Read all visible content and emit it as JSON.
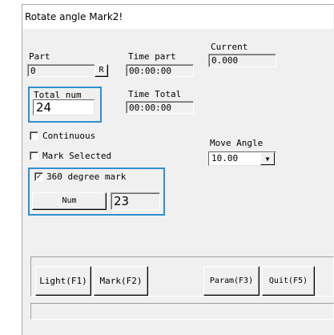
{
  "window": {
    "title": "Rotate angle Mark2!"
  },
  "part": {
    "label": "Part",
    "value": "0",
    "r_button": "R"
  },
  "time_part": {
    "label": "Time part",
    "value": "00:00:00"
  },
  "time_total": {
    "label": "Time Total",
    "value": "00:00:00"
  },
  "current": {
    "label": "Current",
    "value": "0.000"
  },
  "total_num": {
    "label": "Total num",
    "value": "24"
  },
  "continuous": {
    "label": "Continuous",
    "checked": false
  },
  "mark_selected": {
    "label": "Mark Selected",
    "checked": false
  },
  "move_angle": {
    "label": "Move Angle",
    "value": "10.00"
  },
  "degree_mark": {
    "label": "360 degree mark",
    "checked": true,
    "check_glyph": "✓"
  },
  "num": {
    "button_label": "Num",
    "value": "23"
  },
  "buttons": {
    "light": "Light(F1)",
    "mark": "Mark(F2)",
    "param": "Param(F3)",
    "quit": "Quit(F5)"
  },
  "colors": {
    "highlight": "#2e8fd0",
    "dialog_bg": "#f0f0f0"
  },
  "icons": {
    "combo_arrow": "triangle-down-icon"
  }
}
